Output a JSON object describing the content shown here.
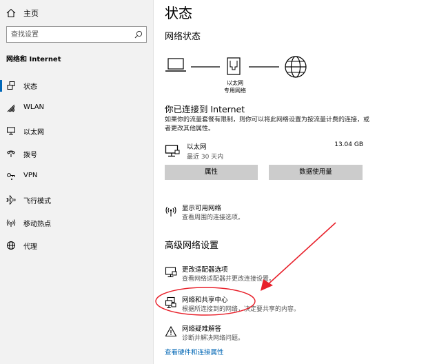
{
  "sidebar": {
    "home_label": "主页",
    "search_placeholder": "查找设置",
    "section_title": "网络和 Internet",
    "items": [
      {
        "label": "状态",
        "icon": "status-icon"
      },
      {
        "label": "WLAN",
        "icon": "wifi-icon"
      },
      {
        "label": "以太网",
        "icon": "ethernet-icon"
      },
      {
        "label": "拨号",
        "icon": "dialup-icon"
      },
      {
        "label": "VPN",
        "icon": "vpn-icon"
      },
      {
        "label": "飞行模式",
        "icon": "airplane-icon"
      },
      {
        "label": "移动热点",
        "icon": "hotspot-icon"
      },
      {
        "label": "代理",
        "icon": "globe-icon"
      }
    ],
    "active_index": 0
  },
  "main": {
    "title": "状态",
    "network_status_heading": "网络状态",
    "topology": {
      "label_line1": "以太网",
      "label_line2": "专用网络"
    },
    "connected_heading": "你已连接到 Internet",
    "description": "如果你的流量套餐有限制，则你可以将此网络设置为按流量计费的连接，或者更改其他属性。",
    "ethernet": {
      "name": "以太网",
      "subtitle": "最近 30 天内",
      "usage": "13.04 GB"
    },
    "buttons": {
      "properties": "属性",
      "data_usage": "数据使用量"
    },
    "show_networks": {
      "title": "显示可用网络",
      "subtitle": "查看周围的连接选项。"
    },
    "advanced_heading": "高级网络设置",
    "adapter_options": {
      "title": "更改适配器选项",
      "subtitle": "查看网络适配器并更改连接设置。"
    },
    "sharing_center": {
      "title": "网络和共享中心",
      "subtitle": "根据所连接到的网络，决定要共享的内容。"
    },
    "troubleshooter": {
      "title": "网络疑难解答",
      "subtitle": "诊断并解决网络问题。"
    },
    "hardware_link": "查看硬件和连接属性"
  },
  "colors": {
    "accent": "#0067b8",
    "link": "#0066b4",
    "annotation": "#e8202a"
  }
}
